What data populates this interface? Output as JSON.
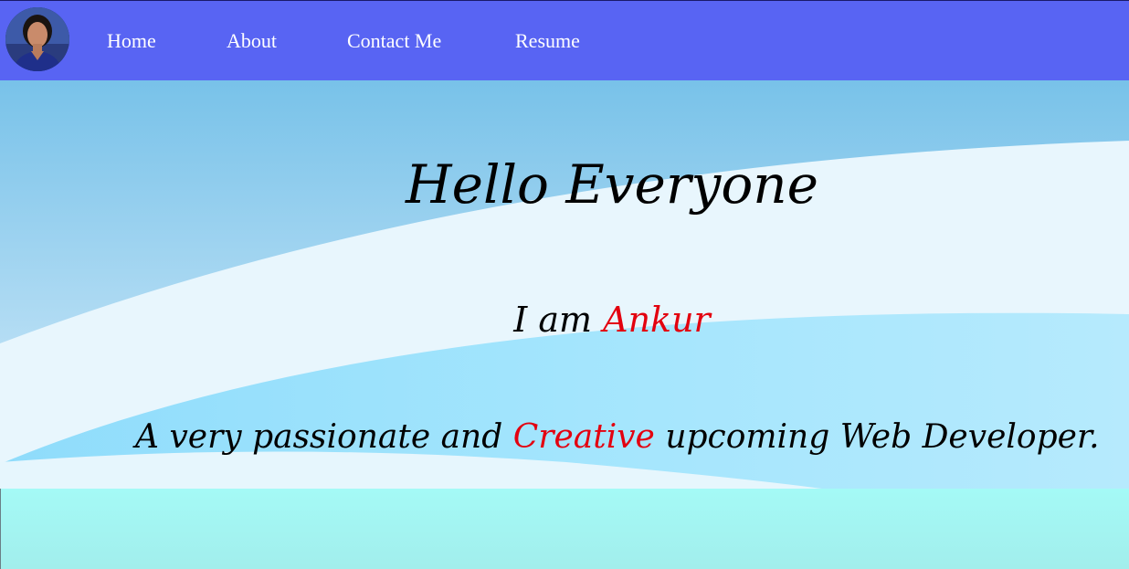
{
  "nav": {
    "avatar_alt": "Profile photo",
    "links": [
      {
        "label": "Home"
      },
      {
        "label": "About"
      },
      {
        "label": "Contact Me"
      },
      {
        "label": "Resume"
      }
    ]
  },
  "hero": {
    "title": "Hello Everyone",
    "intro_prefix": "I am ",
    "intro_name": "Ankur",
    "tagline_prefix": "A very passionate and ",
    "tagline_accent": "Creative",
    "tagline_suffix": " upcoming Web Developer."
  },
  "colors": {
    "navbar": "#5864f3",
    "accent": "#e3000f",
    "hero_sky": "#7cc4ea",
    "hero_light": "#e8f7fe",
    "hero_wave": "#9fe1fb",
    "bottom_band": "#a4faf6"
  }
}
